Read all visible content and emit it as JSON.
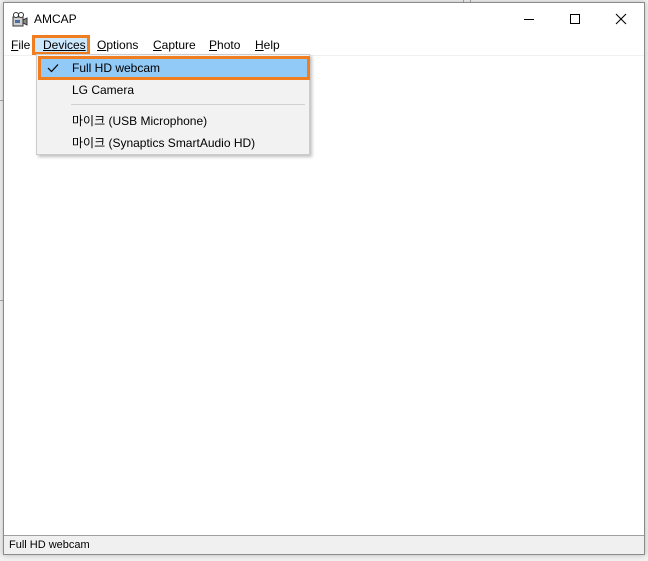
{
  "window": {
    "title": "AMCAP",
    "icons": {
      "app": "camcorder-icon",
      "minimize": "minimize-icon",
      "maximize": "maximize-icon",
      "close": "close-icon"
    }
  },
  "menubar": {
    "items": [
      {
        "label": "File",
        "accel": "F",
        "rest": "ile"
      },
      {
        "label": "Devices",
        "accel": "D",
        "rest": "evices"
      },
      {
        "label": "Options",
        "accel": "O",
        "rest": "ptions"
      },
      {
        "label": "Capture",
        "accel": "C",
        "rest": "apture"
      },
      {
        "label": "Photo",
        "accel": "P",
        "rest": "hoto"
      },
      {
        "label": "Help",
        "accel": "H",
        "rest": "elp"
      }
    ],
    "active": "Devices"
  },
  "devices_menu": {
    "items": [
      {
        "label": "Full HD webcam",
        "checked": true
      },
      {
        "label": "LG Camera",
        "checked": false
      },
      {
        "label": "마이크 (USB Microphone)",
        "checked": false
      },
      {
        "label": "마이크 (Synaptics SmartAudio HD)",
        "checked": false
      }
    ]
  },
  "statusbar": {
    "text": "Full HD webcam"
  },
  "colors": {
    "highlight_border": "#f07d1f",
    "selected_bg": "#91c9f7",
    "menu_bg": "#f2f2f2"
  }
}
